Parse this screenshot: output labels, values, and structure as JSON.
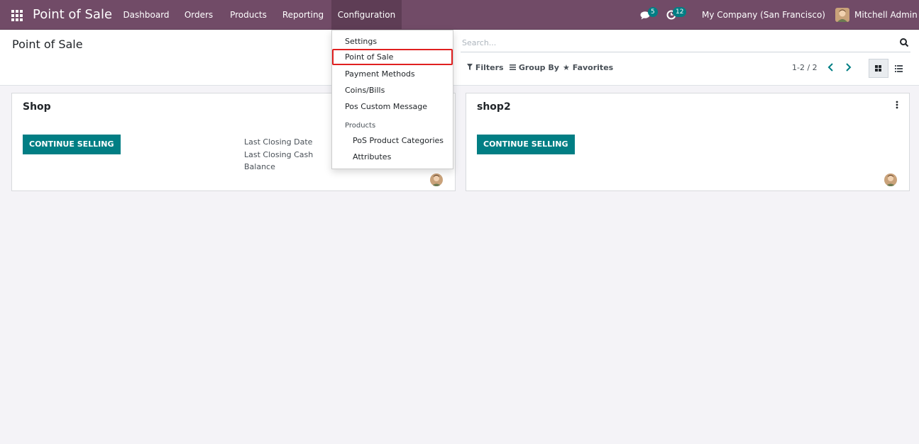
{
  "navbar": {
    "app_title": "Point of Sale",
    "menu": [
      "Dashboard",
      "Orders",
      "Products",
      "Reporting",
      "Configuration"
    ],
    "messages_count": "5",
    "activities_count": "12",
    "company": "My Company (San Francisco)",
    "user": "Mitchell Admin"
  },
  "control_panel": {
    "title": "Point of Sale",
    "search_placeholder": "Search...",
    "filters_label": "Filters",
    "groupby_label": "Group By",
    "favorites_label": "Favorites",
    "pager": "1-2 / 2"
  },
  "config_dropdown": {
    "items": [
      "Settings",
      "Point of Sale",
      "Payment Methods",
      "Coins/Bills",
      "Pos Custom Message"
    ],
    "section_header": "Products",
    "sub_items": [
      "PoS Product Categories",
      "Attributes"
    ]
  },
  "cards": [
    {
      "name": "Shop",
      "button": "CONTINUE SELLING",
      "closing_date_label": "Last Closing Date",
      "closing_cash_label": "Last Closing Cash",
      "balance_label": "Balance"
    },
    {
      "name": "shop2",
      "button": "CONTINUE SELLING"
    }
  ],
  "colors": {
    "brand": "#714b67",
    "accent": "#017e84",
    "highlight": "#e02020"
  }
}
